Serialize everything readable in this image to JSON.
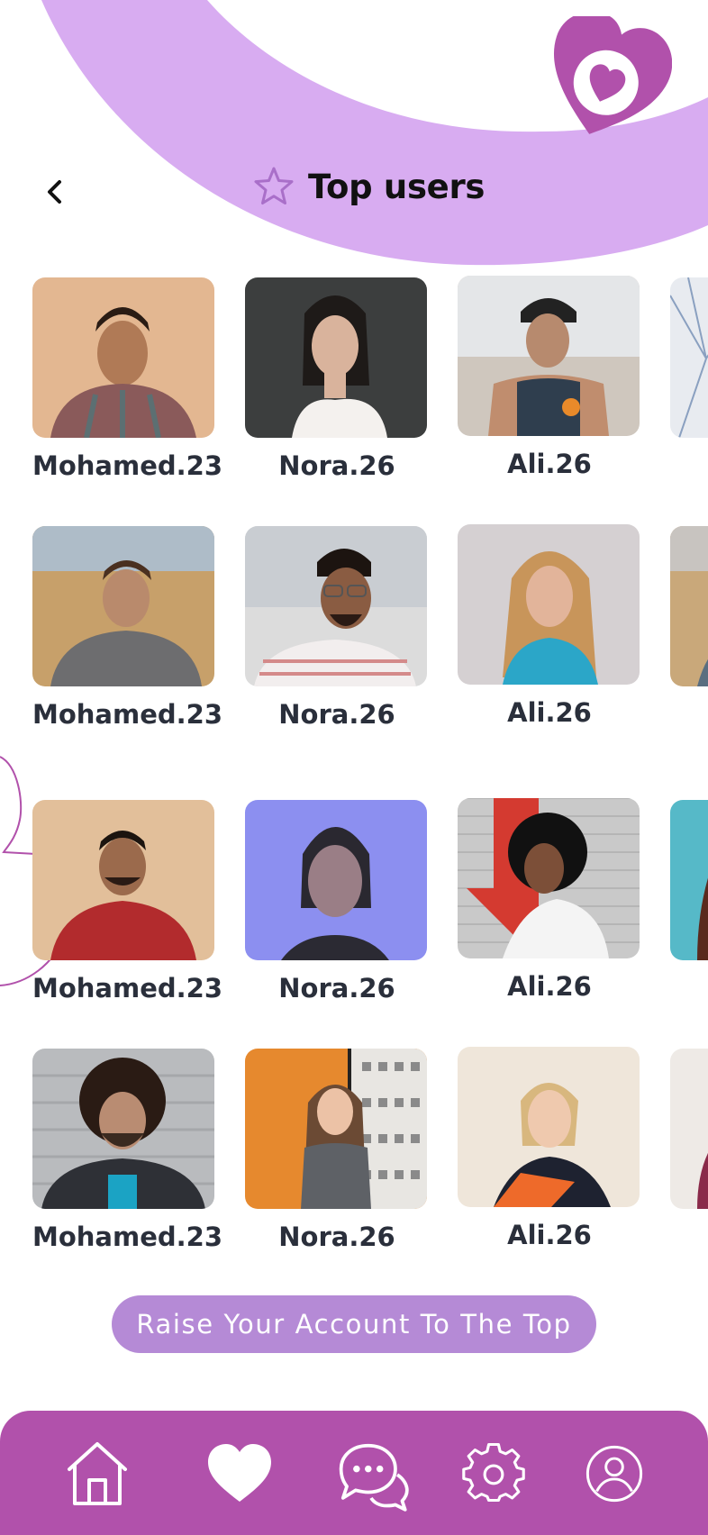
{
  "header": {
    "title": "Top users",
    "back_icon": "chevron-left-icon",
    "title_icon": "star-icon",
    "logo_icon": "heart-logo-icon"
  },
  "users": [
    {
      "name": "Mohamed.23",
      "photo": "man-plaid-shirt-portrait"
    },
    {
      "name": "Nora.26",
      "photo": "woman-dark-background-portrait"
    },
    {
      "name": "Ali.26",
      "photo": "man-cap-tank-top-portrait"
    },
    {
      "name": "Mohamed.23",
      "photo": "man-grey-hoodie-field-portrait"
    },
    {
      "name": "Nora.26",
      "photo": "man-glasses-striped-shirt-portrait"
    },
    {
      "name": "Ali.26",
      "photo": "woman-blonde-smiling-portrait"
    },
    {
      "name": "Mohamed.23",
      "photo": "man-red-tshirt-portrait"
    },
    {
      "name": "Nora.26",
      "photo": "woman-blue-light-portrait"
    },
    {
      "name": "Ali.26",
      "photo": "woman-curly-hair-white-jacket-portrait"
    },
    {
      "name": "Mohamed.23",
      "photo": "man-curly-hair-brick-wall-portrait"
    },
    {
      "name": "Nora.26",
      "photo": "woman-grey-blazer-portrait"
    },
    {
      "name": "Ali.26",
      "photo": "woman-blonde-orange-folder-portrait"
    }
  ],
  "cta": {
    "label": "Raise Your Account To The Top"
  },
  "bottom_nav": [
    {
      "icon": "home-icon"
    },
    {
      "icon": "heart-icon"
    },
    {
      "icon": "chat-icon"
    },
    {
      "icon": "settings-icon"
    },
    {
      "icon": "profile-icon"
    }
  ],
  "colors": {
    "primary_purple": "#b151ab",
    "light_purple": "#d8acf1",
    "cta_purple": "#b58ad6",
    "text_dark": "#2a2f3b"
  }
}
